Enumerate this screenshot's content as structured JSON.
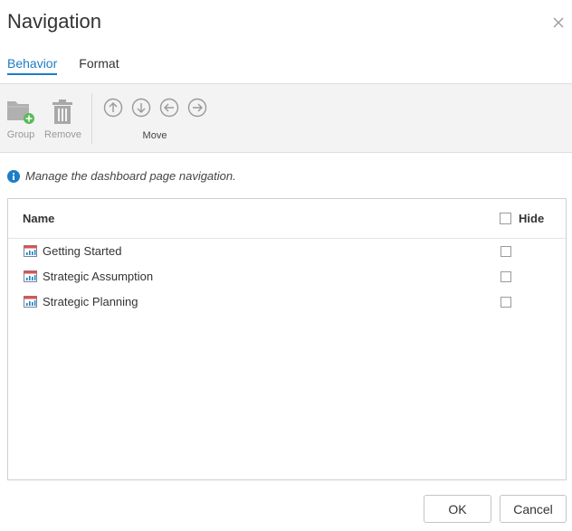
{
  "dialog": {
    "title": "Navigation"
  },
  "tabs": [
    {
      "label": "Behavior",
      "active": true
    },
    {
      "label": "Format",
      "active": false
    }
  ],
  "toolbar": {
    "group_label": "Group",
    "remove_label": "Remove",
    "move_label": "Move"
  },
  "info_text": "Manage the dashboard page navigation.",
  "grid": {
    "name_header": "Name",
    "hide_header": "Hide",
    "rows": [
      {
        "label": "Getting Started",
        "hidden": false
      },
      {
        "label": "Strategic Assumption",
        "hidden": false
      },
      {
        "label": "Strategic Planning",
        "hidden": false
      }
    ]
  },
  "footer": {
    "ok_label": "OK",
    "cancel_label": "Cancel"
  },
  "colors": {
    "accent": "#1c7ec4",
    "info": "#1c7ec4",
    "add_badge": "#5bb95b"
  }
}
